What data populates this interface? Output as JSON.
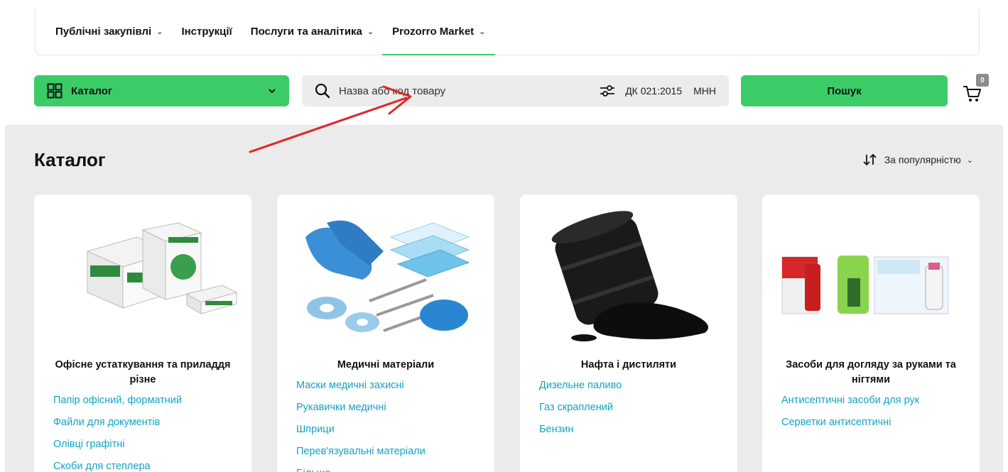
{
  "nav": {
    "items": [
      {
        "label": "Публічні закупівлі",
        "has_dropdown": true
      },
      {
        "label": "Інструкції",
        "has_dropdown": false
      },
      {
        "label": "Послуги та аналітика",
        "has_dropdown": true
      },
      {
        "label": "Prozorro Market",
        "has_dropdown": true,
        "active": true
      }
    ]
  },
  "toolbar": {
    "catalog_label": "Каталог",
    "search_placeholder": "Назва або код товару",
    "dk_label": "ДК 021:2015",
    "mnn_label": "МНН",
    "search_button": "Пошук",
    "cart_count": "0"
  },
  "catalog": {
    "title": "Каталог",
    "sort_label": "За популярністю",
    "cards": [
      {
        "title": "Офісне устаткування та приладдя різне",
        "image": "office-paper",
        "links": [
          "Папір офісний, форматний",
          "Файли для документів",
          "Олівці графітні",
          "Скоби для степлера"
        ]
      },
      {
        "title": "Медичні матеріали",
        "image": "medical-supplies",
        "links": [
          "Маски медичні захисні",
          "Рукавички медичні",
          "Шприци",
          "Перев'язувальні матеріали",
          "Більше"
        ]
      },
      {
        "title": "Нафта і дистиляти",
        "image": "oil-barrel",
        "links": [
          "Дизельне паливо",
          "Газ скраплений",
          "Бензин"
        ]
      },
      {
        "title": "Засоби для догляду за руками та нігтями",
        "image": "nail-care",
        "links": [
          "Антисептичні засоби для рук",
          "Серветки антисептичні"
        ]
      }
    ]
  },
  "colors": {
    "accent": "#3ccc67",
    "link": "#13a2c6",
    "annotation": "#e0262a"
  }
}
